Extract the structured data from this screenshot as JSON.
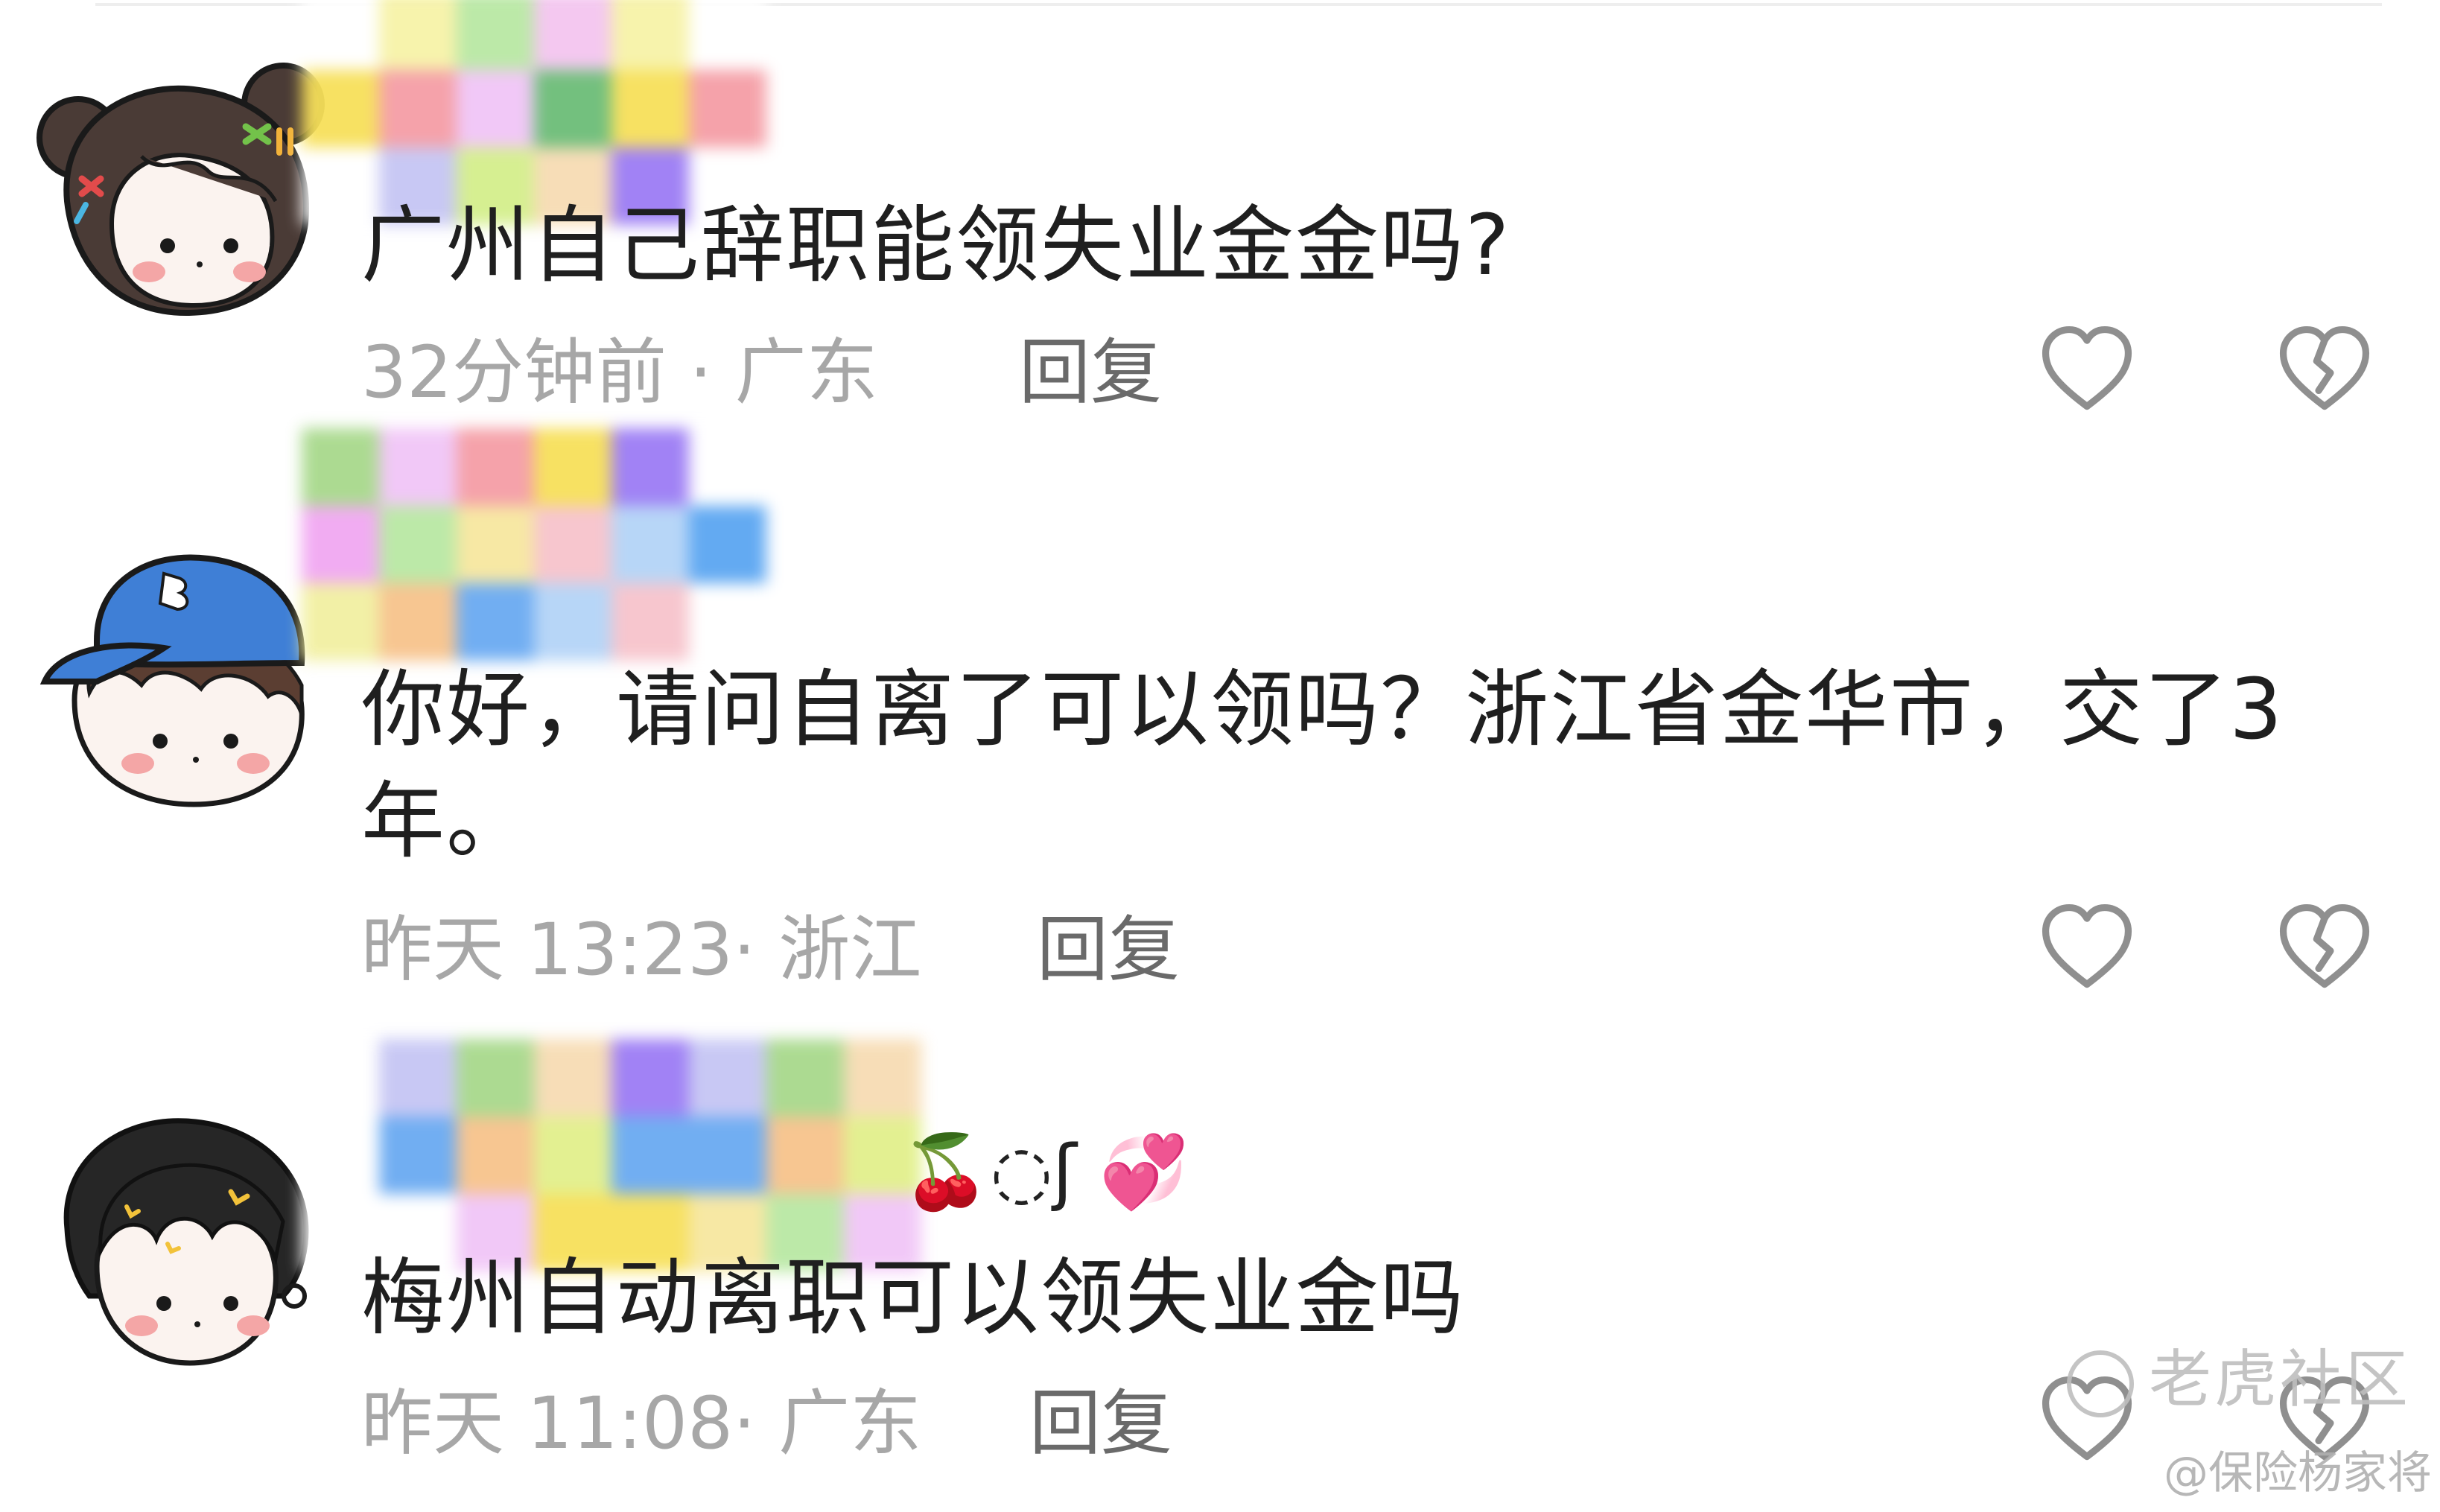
{
  "comments": [
    {
      "username_suffix": "",
      "text": "广州自己辞职能领失业金金吗?",
      "time": "32分钟前",
      "separator": " · ",
      "location": "广东",
      "reply_label": "回复"
    },
    {
      "username_suffix": "",
      "text": "你好，请问自离了可以领吗？浙江省金华市，交了3年。",
      "time": "昨天 13:23",
      "separator": "· ",
      "location": "浙江",
      "reply_label": "回复"
    },
    {
      "username_suffix": "🍒◌ʃ 💞",
      "text": "梅州自动离职可以领失业金吗",
      "time": "昨天 11:08",
      "separator": "· ",
      "location": "广东",
      "reply_label": "回复"
    }
  ],
  "icons": {
    "like": "heart-outline-icon",
    "dislike": "broken-heart-icon"
  },
  "watermark": {
    "logo_text": "老虎社区",
    "credit": "@保险杨家将"
  },
  "colors": {
    "text": "#1f1f1f",
    "meta": "#a7a7a7",
    "reply": "#6a6a6a",
    "icon": "#8f8f8f"
  }
}
